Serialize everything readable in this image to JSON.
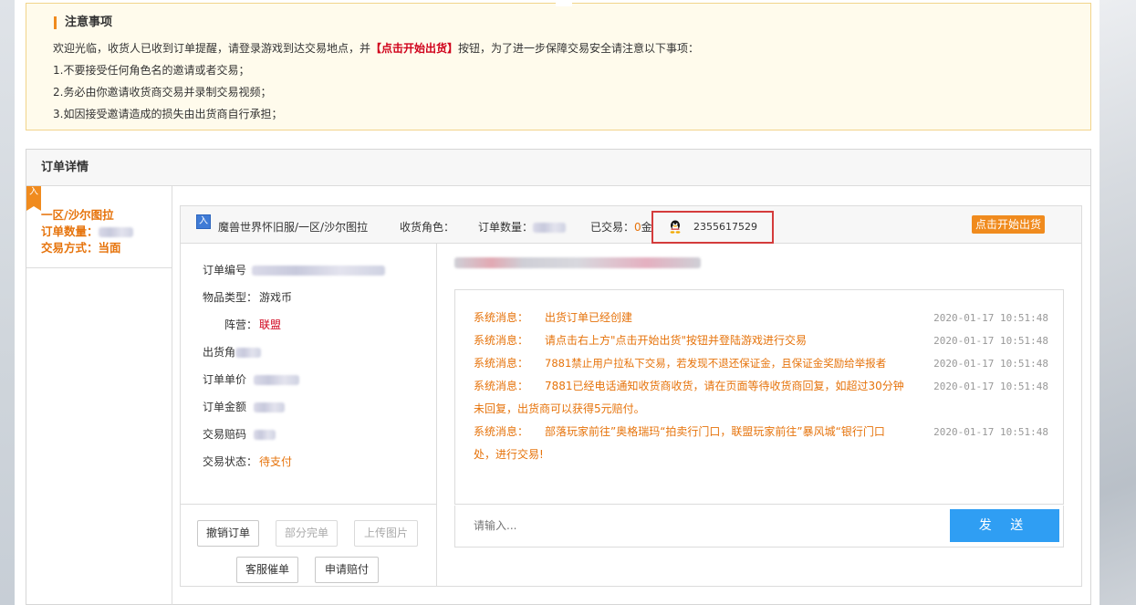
{
  "notice": {
    "title": "注意事项",
    "intro_before": "欢迎光临，收货人已收到订单提醒，请登录游戏到达交易地点，并",
    "intro_highlight": "【点击开始出货】",
    "intro_after": "按钮，为了进一步保障交易安全请注意以下事项：",
    "items": [
      "1.不要接受任何角色名的邀请或者交易；",
      "2.务必由你邀请收货商交易并录制交易视频；",
      "3.如因接受邀请造成的损失由出货商自行承担；"
    ]
  },
  "order": {
    "section_title": "订单详情",
    "summary": {
      "ribbon": "入",
      "server": "一区/沙尔图拉",
      "qty_label": "订单数量：",
      "mode_label": "交易方式：",
      "mode_value": "当面"
    },
    "header": {
      "game": "魔兽世界怀旧服/一区/沙尔图拉",
      "role_label": "收货角色：",
      "qty_label": "订单数量：",
      "traded_label": "已交易：",
      "traded_value": "0",
      "traded_unit": "金",
      "qq": "2355617529",
      "start_button": "点击开始出货"
    },
    "info": {
      "order_no_label": "订单编号",
      "item_type_label": "物品类型：",
      "item_type_value": "游戏币",
      "faction_label": "阵营：",
      "faction_value": "联盟",
      "seller_label": "出货角",
      "price_label": "订单单价",
      "amount_label": "订单金额",
      "compensation_label": "交易赔码",
      "status_label": "交易状态：",
      "status_value": "待支付"
    },
    "buttons": {
      "cancel": "撤销订单",
      "partial": "部分完单",
      "upload": "上传图片",
      "urge": "客服催单",
      "claim": "申请赔付"
    },
    "chat": {
      "messages": [
        {
          "label": "系统消息：",
          "text": "出货订单已经创建",
          "time": "2020-01-17 10:51:48"
        },
        {
          "label": "系统消息：",
          "text": "请点击右上方\"点击开始出货\"按钮并登陆游戏进行交易",
          "time": "2020-01-17 10:51:48"
        },
        {
          "label": "系统消息：",
          "text": "7881禁止用户拉私下交易，若发现不退还保证金，且保证金奖励给举报者",
          "time": "2020-01-17 10:51:48"
        },
        {
          "label": "系统消息：",
          "text": "7881已经电话通知收货商收货，请在页面等待收货商回复，如超过30分钟未回复，出货商可以获得5元赔付。",
          "time": "2020-01-17 10:51:48"
        },
        {
          "label": "系统消息：",
          "text": "部落玩家前往”奥格瑞玛“拍卖行门口，联盟玩家前往”暴风城“银行门口处，进行交易!",
          "time": "2020-01-17 10:51:48"
        }
      ],
      "input_placeholder": "请输入...",
      "send_label": "发 送"
    }
  },
  "colors": {
    "accent_orange": "#f08b1e",
    "text_orange": "#e6730b",
    "highlight_red": "#d0021b",
    "send_blue": "#2f9ef3",
    "notice_bg": "#fffbec"
  }
}
